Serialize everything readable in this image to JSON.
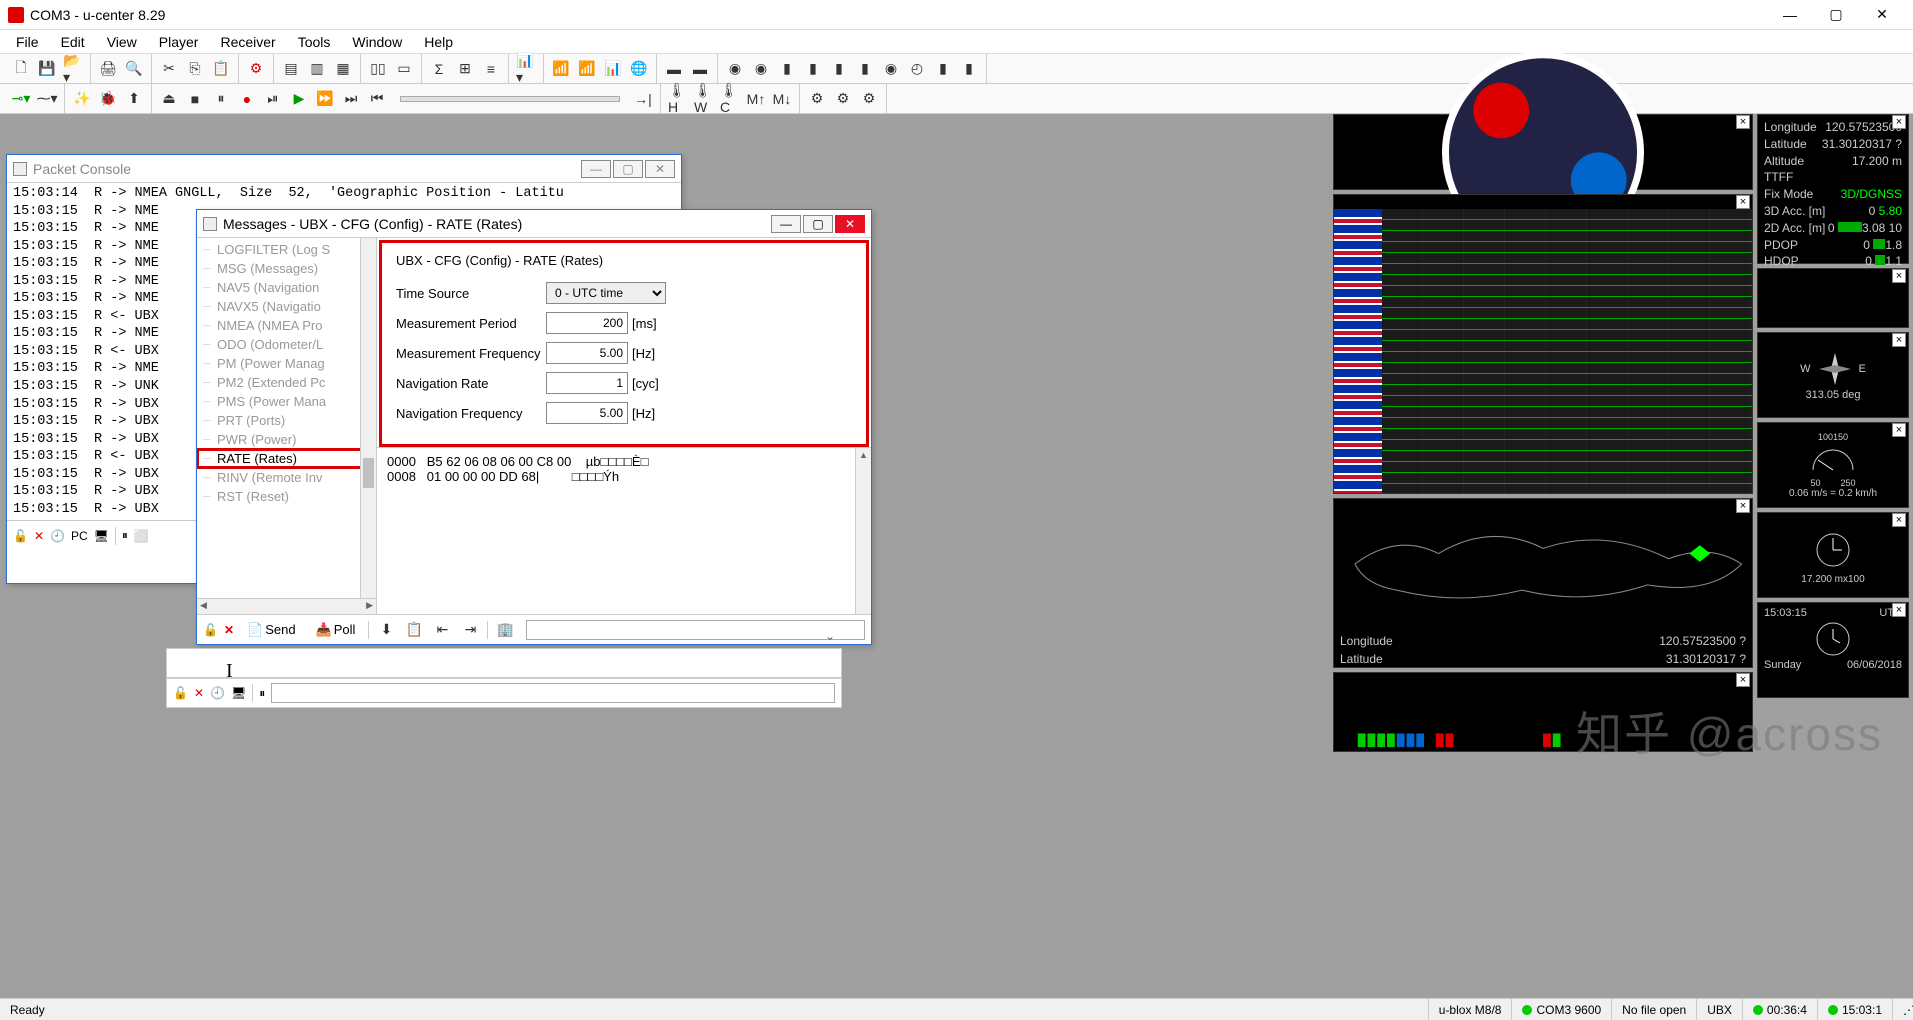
{
  "window": {
    "title": "COM3 - u-center 8.29"
  },
  "menu": [
    "File",
    "Edit",
    "View",
    "Player",
    "Receiver",
    "Tools",
    "Window",
    "Help"
  ],
  "packet_console": {
    "title": "Packet Console",
    "lines": [
      "15:03:14  R -> NMEA GNGLL,  Size  52,  'Geographic Position - Latitu",
      "15:03:15  R -> NME",
      "15:03:15  R -> NME",
      "15:03:15  R -> NME",
      "15:03:15  R -> NME",
      "15:03:15  R -> NME",
      "15:03:15  R -> NME",
      "15:03:15  R <- UBX",
      "15:03:15  R -> NME",
      "15:03:15  R <- UBX",
      "15:03:15  R -> NME",
      "15:03:15  R -> UNK",
      "15:03:15  R -> UBX",
      "15:03:15  R -> UBX",
      "15:03:15  R -> UBX",
      "15:03:15  R <- UBX",
      "15:03:15  R -> UBX",
      "15:03:15  R -> UBX",
      "15:03:15  R -> UBX"
    ]
  },
  "messages": {
    "title": "Messages - UBX - CFG (Config) - RATE (Rates)",
    "tree": [
      "LOGFILTER (Log S",
      "MSG (Messages)",
      "NAV5 (Navigation",
      "NAVX5 (Navigatio",
      "NMEA (NMEA Pro",
      "ODO (Odometer/L",
      "PM (Power Manag",
      "PM2 (Extended Pc",
      "PMS (Power Mana",
      "PRT (Ports)",
      "PWR (Power)",
      "RATE (Rates)",
      "RINV (Remote Inv",
      "RST (Reset)"
    ],
    "tree_selected": 11,
    "form": {
      "title": "UBX - CFG (Config) - RATE (Rates)",
      "time_source_label": "Time Source",
      "time_source_value": "0 - UTC time",
      "meas_period_label": "Measurement Period",
      "meas_period_value": "200",
      "meas_period_unit": "[ms]",
      "meas_freq_label": "Measurement Frequency",
      "meas_freq_value": "5.00",
      "meas_freq_unit": "[Hz]",
      "nav_rate_label": "Navigation Rate",
      "nav_rate_value": "1",
      "nav_rate_unit": "[cyc]",
      "nav_freq_label": "Navigation Frequency",
      "nav_freq_value": "5.00",
      "nav_freq_unit": "[Hz]"
    },
    "hex": [
      "0000   B5 62 06 08 06 00 C8 00    µb□□□□È□",
      "0008   01 00 00 00 DD 68|         □□□□Ýh"
    ],
    "toolbar": {
      "send": "Send",
      "poll": "Poll"
    }
  },
  "info_panel": {
    "Longitude": "120.57523500",
    "Latitude": "31.30120317 ?",
    "Altitude": "17.200 m",
    "TTFF": "",
    "FixMode": "3D/DGNSS",
    "3DAcc": {
      "label": "3D Acc. [m]",
      "val": "0",
      "extra": "5.80"
    },
    "2DAcc": {
      "label": "2D Acc. [m]",
      "val": "0",
      "barcolor": "#0a0",
      "barw": "24px",
      "extra": "3.08  10"
    },
    "PDOP": {
      "val": "0",
      "barcolor": "#0a0",
      "barw": "12px",
      "extra": "1.8"
    },
    "HDOP": {
      "val": "0",
      "barcolor": "#0a0",
      "barw": "10px",
      "extra": "1.1"
    },
    "Satellites": ""
  },
  "compass": {
    "wlabel": "W",
    "elabel": "E",
    "heading": "313.05 deg"
  },
  "speed": {
    "t1": "100150",
    "t2": "50",
    "t3": "250",
    "text": "0.06 m/s = 0.2 km/h"
  },
  "altitude": {
    "alt": "17.200 m",
    "x": "x100"
  },
  "clock": {
    "time": "15:03:15",
    "tz": "UTC",
    "day": "Sunday",
    "date": "06/06/2018"
  },
  "map_coords": {
    "lon_label": "Longitude",
    "lon_val": "120.57523500 ?",
    "lat_label": "Latitude",
    "lat_val": "31.30120317 ?"
  },
  "statusbar": {
    "ready": "Ready",
    "device": "u-blox M8/8",
    "port": "COM3 9600",
    "file": "No file open",
    "proto": "UBX",
    "t1": "00:36:4",
    "t2": "15:03:1"
  },
  "watermark": "知乎 @across"
}
